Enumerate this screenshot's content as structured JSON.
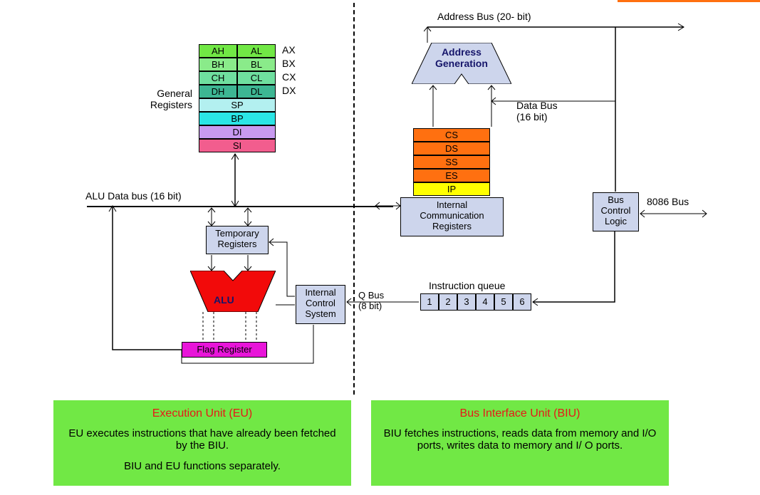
{
  "labels": {
    "general_registers": "General\nRegisters",
    "alu_data_bus": "ALU Data bus (16 bit)",
    "temp_reg": "Temporary\nRegisters",
    "alu": "ALU",
    "internal_control": "Internal\nControl\nSystem",
    "flag_register": "Flag Register",
    "address_bus": "Address Bus (20- bit)",
    "address_gen": "Address\nGeneration",
    "data_bus": "Data Bus\n(16 bit)",
    "internal_comm": "Internal\nCommunication\nRegisters",
    "bus_control": "Bus\nControl\nLogic",
    "bus_8086": "8086 Bus",
    "q_bus": "Q Bus\n(8 bit)",
    "instruction_queue": "Instruction queue"
  },
  "gp_registers": [
    {
      "hi": "AH",
      "lo": "AL",
      "full": "AX",
      "color": "#71e845"
    },
    {
      "hi": "BH",
      "lo": "BL",
      "full": "BX",
      "color": "#8aeb8a"
    },
    {
      "hi": "CH",
      "lo": "CL",
      "full": "CX",
      "color": "#6fdf9f"
    },
    {
      "hi": "DH",
      "lo": "DL",
      "full": "DX",
      "color": "#3db693"
    }
  ],
  "pointer_registers": [
    {
      "name": "SP",
      "color": "#b3f0f0"
    },
    {
      "name": "BP",
      "color": "#2be5e5"
    },
    {
      "name": "DI",
      "color": "#c89af0"
    },
    {
      "name": "SI",
      "color": "#f25d8e"
    }
  ],
  "segment_registers": [
    {
      "name": "CS",
      "color": "#ff7010"
    },
    {
      "name": "DS",
      "color": "#ff7010"
    },
    {
      "name": "SS",
      "color": "#ff7010"
    },
    {
      "name": "ES",
      "color": "#ff7010"
    },
    {
      "name": "IP",
      "color": "#ffff00"
    }
  ],
  "queue": [
    "1",
    "2",
    "3",
    "4",
    "5",
    "6"
  ],
  "eu_panel": {
    "title": "Execution Unit (EU)",
    "line1": "EU executes instructions that have already been fetched by the BIU.",
    "line2": "BIU and EU functions separately."
  },
  "biu_panel": {
    "title": "Bus Interface Unit (BIU)",
    "line1": "BIU fetches instructions, reads data from memory and I/O ports, writes data to memory and I/ O ports."
  }
}
